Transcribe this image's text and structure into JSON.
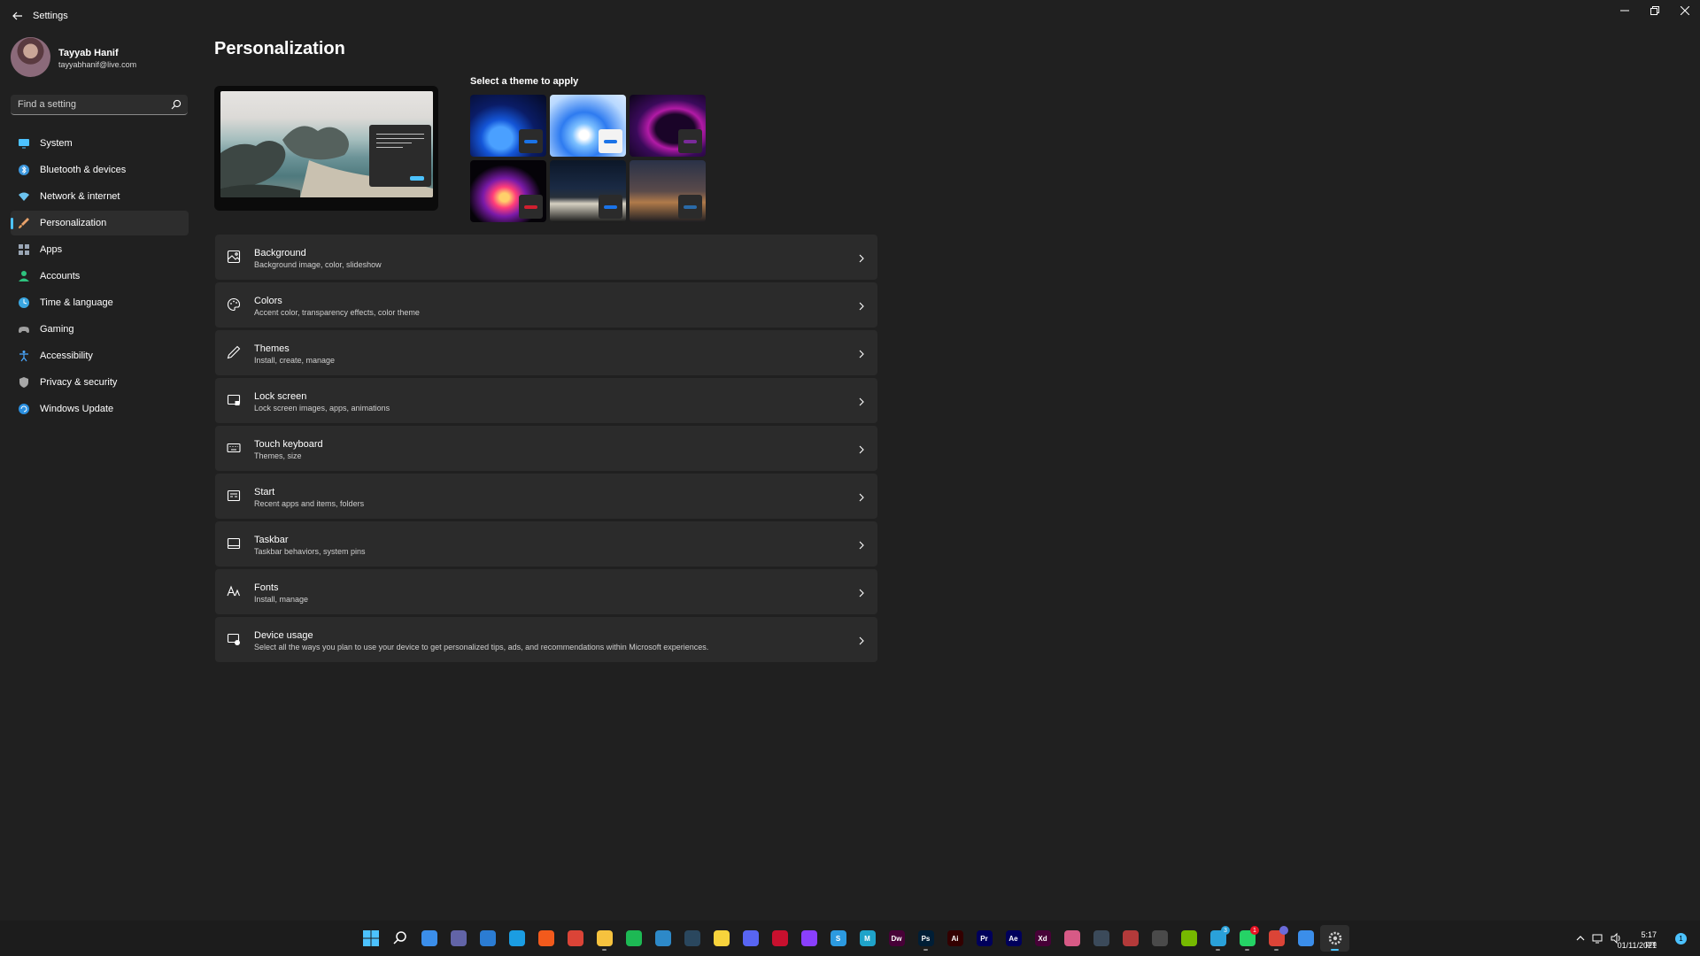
{
  "window": {
    "title": "Settings"
  },
  "profile": {
    "name": "Tayyab Hanif",
    "email": "tayyabhanif@live.com"
  },
  "search": {
    "placeholder": "Find a setting"
  },
  "nav": {
    "items": [
      {
        "label": "System",
        "icon": "monitor-icon",
        "color": "#4cc2ff"
      },
      {
        "label": "Bluetooth & devices",
        "icon": "bluetooth-icon",
        "color": "#3a96dd"
      },
      {
        "label": "Network & internet",
        "icon": "wifi-icon",
        "color": "#6cc4f0"
      },
      {
        "label": "Personalization",
        "icon": "brush-icon",
        "color": "#e8a26b"
      },
      {
        "label": "Apps",
        "icon": "apps-icon",
        "color": "#9aa6b5"
      },
      {
        "label": "Accounts",
        "icon": "person-icon",
        "color": "#2ec27e"
      },
      {
        "label": "Time & language",
        "icon": "globe-clock-icon",
        "color": "#3aa6e0"
      },
      {
        "label": "Gaming",
        "icon": "gamepad-icon",
        "color": "#a0a0a0"
      },
      {
        "label": "Accessibility",
        "icon": "accessibility-icon",
        "color": "#4aa8ff"
      },
      {
        "label": "Privacy & security",
        "icon": "shield-icon",
        "color": "#a8a8a8"
      },
      {
        "label": "Windows Update",
        "icon": "update-icon",
        "color": "#2a8fe0"
      }
    ],
    "active_index": 3
  },
  "page": {
    "title": "Personalization",
    "theme_heading": "Select a theme to apply"
  },
  "themes": [
    {
      "name": "windows-light-bloom",
      "accent": "#1a73e8"
    },
    {
      "name": "windows-bloom-light",
      "accent": "#1a73e8"
    },
    {
      "name": "glow",
      "accent": "#7a2a9a"
    },
    {
      "name": "captured-motion",
      "accent": "#d01f2f"
    },
    {
      "name": "sunrise-road",
      "accent": "#1a73e8"
    },
    {
      "name": "flow",
      "accent": "#2a6aa8"
    }
  ],
  "cards": [
    {
      "title": "Background",
      "subtitle": "Background image, color, slideshow",
      "icon": "image-icon"
    },
    {
      "title": "Colors",
      "subtitle": "Accent color, transparency effects, color theme",
      "icon": "palette-icon"
    },
    {
      "title": "Themes",
      "subtitle": "Install, create, manage",
      "icon": "pen-icon"
    },
    {
      "title": "Lock screen",
      "subtitle": "Lock screen images, apps, animations",
      "icon": "lock-screen-icon"
    },
    {
      "title": "Touch keyboard",
      "subtitle": "Themes, size",
      "icon": "keyboard-icon"
    },
    {
      "title": "Start",
      "subtitle": "Recent apps and items, folders",
      "icon": "start-icon"
    },
    {
      "title": "Taskbar",
      "subtitle": "Taskbar behaviors, system pins",
      "icon": "taskbar-icon"
    },
    {
      "title": "Fonts",
      "subtitle": "Install, manage",
      "icon": "font-icon"
    },
    {
      "title": "Device usage",
      "subtitle": "Select all the ways you plan to use your device to get personalized tips, ads, and recommendations within Microsoft experiences.",
      "icon": "device-usage-icon"
    }
  ],
  "taskbar": {
    "apps": [
      {
        "name": "start-icon",
        "label": "",
        "color": "#3b8eea"
      },
      {
        "name": "search-icon",
        "label": "",
        "color": "#1c1c1c"
      },
      {
        "name": "task-view-icon",
        "label": "",
        "color": "#3b8eea"
      },
      {
        "name": "teams-chat-icon",
        "label": "",
        "color": "#6264a7"
      },
      {
        "name": "mail-icon",
        "label": "",
        "color": "#2b7cd3"
      },
      {
        "name": "edge-icon",
        "label": "",
        "color": "#1b9de2"
      },
      {
        "name": "brave-icon",
        "label": "",
        "color": "#f25a1c"
      },
      {
        "name": "chrome-icon",
        "label": "",
        "color": "#db4437"
      },
      {
        "name": "file-explorer-icon",
        "label": "",
        "color": "#f6c23e"
      },
      {
        "name": "spotify-icon",
        "label": "",
        "color": "#1db954"
      },
      {
        "name": "sharex-icon",
        "label": "",
        "color": "#2d89c8"
      },
      {
        "name": "steam-icon",
        "label": "",
        "color": "#2a475e"
      },
      {
        "name": "sticky-notes-icon",
        "label": "",
        "color": "#f7d33c"
      },
      {
        "name": "discord-icon",
        "label": "",
        "color": "#5865f2"
      },
      {
        "name": "pdf-icon",
        "label": "",
        "color": "#c8102e"
      },
      {
        "name": "messenger-icon",
        "label": "",
        "color": "#8a3ffc"
      },
      {
        "name": "app-s-icon",
        "label": "S",
        "color": "#2c9ae0"
      },
      {
        "name": "app-m-icon",
        "label": "M",
        "color": "#1fa3c9"
      },
      {
        "name": "dreamweaver-icon",
        "label": "Dw",
        "color": "#470137"
      },
      {
        "name": "photoshop-icon",
        "label": "Ps",
        "color": "#001e36"
      },
      {
        "name": "illustrator-icon",
        "label": "Ai",
        "color": "#330000"
      },
      {
        "name": "premiere-icon",
        "label": "Pr",
        "color": "#00005b"
      },
      {
        "name": "after-effects-icon",
        "label": "Ae",
        "color": "#00005b"
      },
      {
        "name": "xd-icon",
        "label": "Xd",
        "color": "#470137"
      },
      {
        "name": "photos-icon",
        "label": "",
        "color": "#d75a86"
      },
      {
        "name": "davinci-icon",
        "label": "",
        "color": "#3b4a5a"
      },
      {
        "name": "snip-icon",
        "label": "",
        "color": "#b33a3a"
      },
      {
        "name": "calculator-icon",
        "label": "",
        "color": "#4a4a4a"
      },
      {
        "name": "nvidia-icon",
        "label": "",
        "color": "#76b900"
      },
      {
        "name": "telegram-icon",
        "label": "",
        "color": "#2aa1da",
        "badge": "3"
      },
      {
        "name": "whatsapp-icon",
        "label": "",
        "color": "#25d366",
        "badge": "1"
      },
      {
        "name": "chrome-profile-icon",
        "label": "",
        "color": "#db4437",
        "badge": ""
      },
      {
        "name": "notepad-icon",
        "label": "",
        "color": "#3b8eea"
      },
      {
        "name": "settings-icon",
        "label": "",
        "color": "#6b6b6b"
      }
    ],
    "active_app_index": 33,
    "clock": {
      "time": "5:17 pm",
      "date": "01/11/2021"
    },
    "notifications": "1"
  }
}
